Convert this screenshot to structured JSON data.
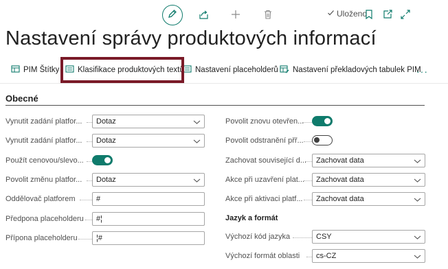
{
  "toolbar": {
    "saved_label": "Uloženo",
    "icons": [
      "edit-icon",
      "share-icon",
      "add-icon",
      "delete-icon",
      "bookmark-icon",
      "open-new-window-icon",
      "expand-icon"
    ]
  },
  "page": {
    "title": "Nastavení správy produktových informací"
  },
  "actions": [
    {
      "label": "PIM Štítky",
      "icon": "table-icon"
    },
    {
      "label": "Klasifikace produktových textů",
      "icon": "list-icon",
      "highlighted": true
    },
    {
      "label": "Nastavení placeholderů",
      "icon": "list-icon"
    },
    {
      "label": "Nastavení překladových tabulek PIM",
      "icon": "table-edit-icon"
    }
  ],
  "more_label": "···",
  "section": {
    "title": "Obecné",
    "left_fields": [
      {
        "label": "Vynutit zadání platfor...",
        "type": "select",
        "value": "Dotaz"
      },
      {
        "label": "Vynutit zadání platfor...",
        "type": "select",
        "value": "Dotaz"
      },
      {
        "label": "Použít cenovou/slevo...",
        "type": "toggle",
        "value": "on"
      },
      {
        "label": "Povolit změnu platfor...",
        "type": "select",
        "value": "Dotaz"
      },
      {
        "label": "Oddělovač platforem",
        "type": "text",
        "value": "#"
      },
      {
        "label": "Předpona placeholderu",
        "type": "text",
        "value": "#¦"
      },
      {
        "label": "Přípona placeholderu",
        "type": "text",
        "value": "¦#"
      }
    ],
    "right_fields": [
      {
        "label": "Povolit znovu otevřen...",
        "type": "toggle",
        "value": "on"
      },
      {
        "label": "Povolit odstranění přř...",
        "type": "toggle",
        "value": "off"
      },
      {
        "label": "Zachovat související d...",
        "type": "select",
        "value": "Zachovat data"
      },
      {
        "label": "Akce při uzavření plat...",
        "type": "select",
        "value": "Zachovat data"
      },
      {
        "label": "Akce při aktivaci platf...",
        "type": "select",
        "value": "Zachovat data"
      }
    ],
    "subsection": {
      "title": "Jazyk a formát",
      "fields": [
        {
          "label": "Výchozí kód jazyka",
          "type": "select",
          "value": "CSY"
        },
        {
          "label": "Výchozí formát oblasti",
          "type": "select",
          "value": "cs-CZ"
        }
      ]
    }
  },
  "colors": {
    "accent": "#0f7b6c",
    "highlight_border": "#7a1a28",
    "text": "#212121",
    "label": "#505050"
  }
}
